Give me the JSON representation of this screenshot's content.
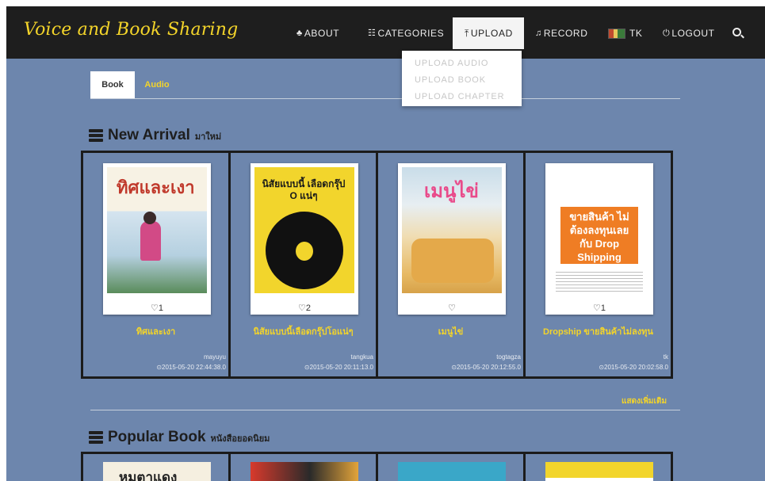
{
  "brand": "Voice and Book Sharing",
  "nav": {
    "about": "ABOUT",
    "categories": "CATEGORIES",
    "upload": "UPLOAD",
    "record": "RECORD",
    "user": "TK",
    "logout": "LOGOUT"
  },
  "upload_menu": [
    "UPLOAD AUDIO",
    "UPLOAD BOOK",
    "UPLOAD CHAPTER"
  ],
  "tabs": {
    "book": "Book",
    "audio": "Audio"
  },
  "new_arrival": {
    "title": "New Arrival",
    "subtitle": "มาใหม่",
    "books": [
      {
        "cover_text": "ทิศและเงา",
        "title": "ทิศและเงา",
        "likes": "1",
        "uploader": "mayuyu",
        "date": "2015-05-20 22:44:38.0"
      },
      {
        "cover_text": "นิสัยแบบนี้ เลือดกรุ๊ป O แน่ๆ",
        "title": "นิสัยแบบนี้เลือดกรุ๊ปโอแน่ๆ",
        "likes": "2",
        "uploader": "tangkua",
        "date": "2015-05-20 20:11:13.0"
      },
      {
        "cover_text": "เมนูไข่",
        "title": "เมนูไข่",
        "likes": "",
        "uploader": "togtagza",
        "date": "2015-05-20 20:12:55.0"
      },
      {
        "cover_text": "ขายสินค้า ไม่ต้องลงทุนเลย กับ Drop Shipping",
        "title": "Dropship ขายสินค้าไม่ลงทุน",
        "likes": "1",
        "uploader": "tk",
        "date": "2015-05-20 20:02:58.0"
      }
    ],
    "more": "แสดงเพิ่มเติม"
  },
  "popular": {
    "title": "Popular Book",
    "subtitle": "หนังสือยอดนิยม",
    "first_cover_text": "หมูตาแดง"
  },
  "colors": {
    "page_bg": "#6d86ad",
    "nav_bg": "#1e1e1e",
    "accent": "#f3d42a"
  }
}
